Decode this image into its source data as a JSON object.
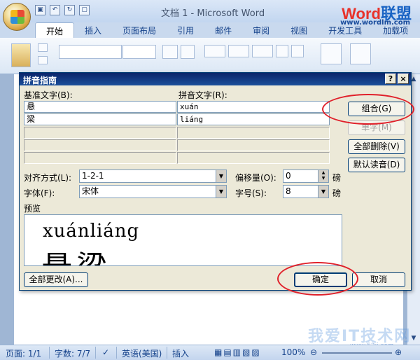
{
  "window": {
    "title": "文档 1 - Microsoft Word",
    "brand_word": "Word",
    "brand_cn": "联盟",
    "brand_url": "www.wordlm.com"
  },
  "ribbon_tabs": [
    "开始",
    "插入",
    "页面布局",
    "引用",
    "邮件",
    "审阅",
    "视图",
    "开发工具",
    "加载项"
  ],
  "dialog": {
    "title": "拼音指南",
    "help": "?",
    "close": "×",
    "base_label": "基准文字(B):",
    "ruby_label": "拼音文字(R):",
    "rows": [
      {
        "base": "悬",
        "ruby": "xuán"
      },
      {
        "base": "梁",
        "ruby": "liáng"
      },
      {
        "base": "",
        "ruby": ""
      },
      {
        "base": "",
        "ruby": ""
      },
      {
        "base": "",
        "ruby": ""
      }
    ],
    "buttons": {
      "group": "组合(G)",
      "mono": "单字(M)",
      "clear_all": "全部删除(V)",
      "default_reading": "默认读音(D)",
      "apply_all": "全部更改(A)...",
      "ok": "确定",
      "cancel": "取消"
    },
    "alignment_label": "对齐方式(L):",
    "alignment_value": "1-2-1",
    "offset_label": "偏移量(O):",
    "offset_value": "0",
    "offset_unit": "磅",
    "font_label": "字体(F):",
    "font_value": "宋体",
    "size_label": "字号(S):",
    "size_value": "8",
    "size_unit": "磅",
    "preview_label": "预览",
    "preview_pinyin": "xuánliáng",
    "preview_han": "悬梁"
  },
  "statusbar": {
    "page": "页面: 1/1",
    "words": "字数: 7/7",
    "language": "英语(美国)",
    "mode": "插入",
    "zoom": "100%"
  },
  "watermark": {
    "text": "我爱IT技术网",
    "url": "www.52ij.com"
  },
  "accent_colors": {
    "annotation": "#e0202a",
    "dialog_title": "#0a246a"
  }
}
